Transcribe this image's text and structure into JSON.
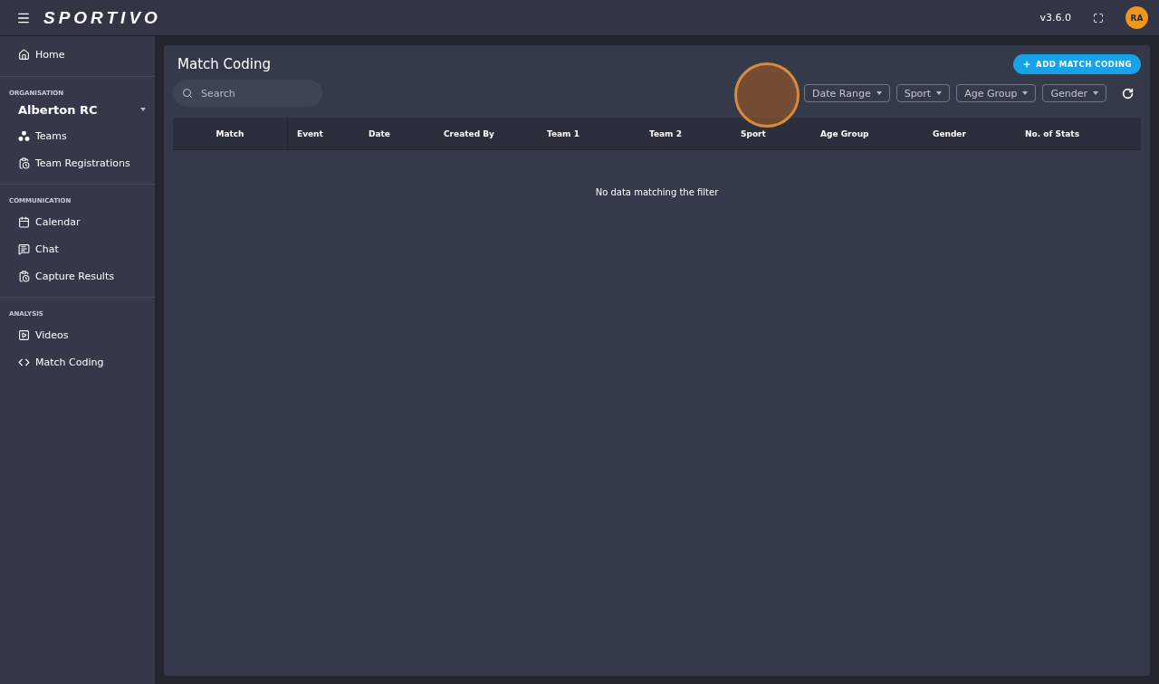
{
  "topbar": {
    "logo": "SPORTIVO",
    "version": "v3.6.0",
    "avatar": "RA"
  },
  "sidebar": {
    "home": {
      "label": "Home"
    },
    "sections": [
      {
        "title": "ORGANISATION",
        "org": "Alberton RC",
        "items": [
          {
            "label": "Teams"
          },
          {
            "label": "Team Registrations"
          }
        ]
      },
      {
        "title": "COMMUNICATION",
        "items": [
          {
            "label": "Calendar"
          },
          {
            "label": "Chat"
          },
          {
            "label": "Capture Results"
          }
        ]
      },
      {
        "title": "ANALYSIS",
        "items": [
          {
            "label": "Videos"
          },
          {
            "label": "Match Coding"
          }
        ]
      }
    ]
  },
  "page": {
    "title": "Match Coding",
    "add_button": "ADD MATCH CODING",
    "search": {
      "placeholder": "Search"
    },
    "filters": [
      "Date Range",
      "Sport",
      "Age Group",
      "Gender"
    ],
    "table": {
      "columns": [
        "Match",
        "Event",
        "Date",
        "Created By",
        "Team 1",
        "Team 2",
        "Sport",
        "Age Group",
        "Gender",
        "No. of Stats"
      ],
      "empty": "No data matching the filter"
    }
  }
}
